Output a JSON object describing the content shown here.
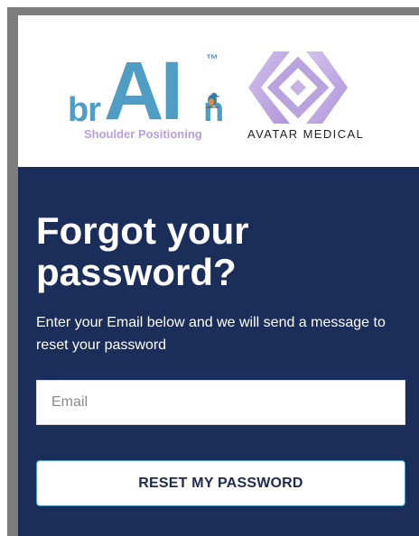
{
  "brand": {
    "brain_prefix": "br",
    "brain_core": "AI",
    "brain_suffix": "n",
    "trademark": "™",
    "tagline": "Shoulder Positioning",
    "partner_name": "AVATAR MEDICAL",
    "colors": {
      "brain_blue": "#4f9cc4",
      "tagline_lilac": "#b79fdc",
      "avatar_lilac": "#b9a3de",
      "panel_navy": "#1b2d59"
    },
    "icons": [
      "kingfisher-bird-icon",
      "avatar-medical-logo-mark"
    ]
  },
  "form": {
    "title": "Forgot your password?",
    "instructions": "Enter your Email below and we will send a message to reset your password",
    "email_value": "",
    "email_placeholder": "Email",
    "submit_label": "RESET MY PASSWORD"
  }
}
